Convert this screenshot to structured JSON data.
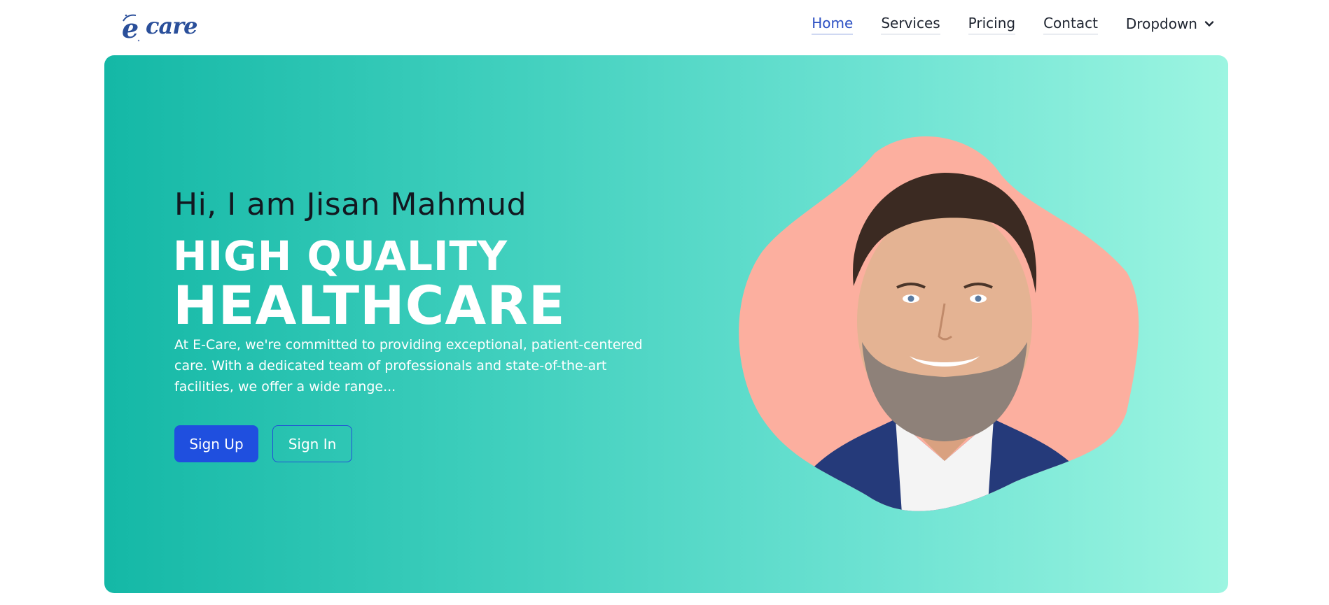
{
  "brand": {
    "logo_text": "care",
    "logo_letter": "e"
  },
  "nav": {
    "items": [
      {
        "label": "Home",
        "active": true
      },
      {
        "label": "Services",
        "active": false
      },
      {
        "label": "Pricing",
        "active": false
      },
      {
        "label": "Contact",
        "active": false
      },
      {
        "label": "Dropdown",
        "active": false,
        "icon": "chevron-down-icon"
      }
    ]
  },
  "hero": {
    "greeting": "Hi, I am Jisan Mahmud",
    "headline_line1": "HIGH QUALITY",
    "headline_line2": "HEALTHCARE",
    "description": "At E-Care, we're committed to providing exceptional, patient-centered care. With a dedicated team of professionals and state-of-the-art facilities, we offer a wide range...",
    "signup_label": "Sign Up",
    "signin_label": "Sign In",
    "portrait_alt": "doctor portrait"
  },
  "colors": {
    "gradient_start": "#14b8a6",
    "gradient_end": "#9cf5e1",
    "primary_button": "#1f4fdf",
    "nav_active": "#2b4fc3",
    "blob": "#fcaf9f",
    "logo": "#2a4f9a"
  }
}
